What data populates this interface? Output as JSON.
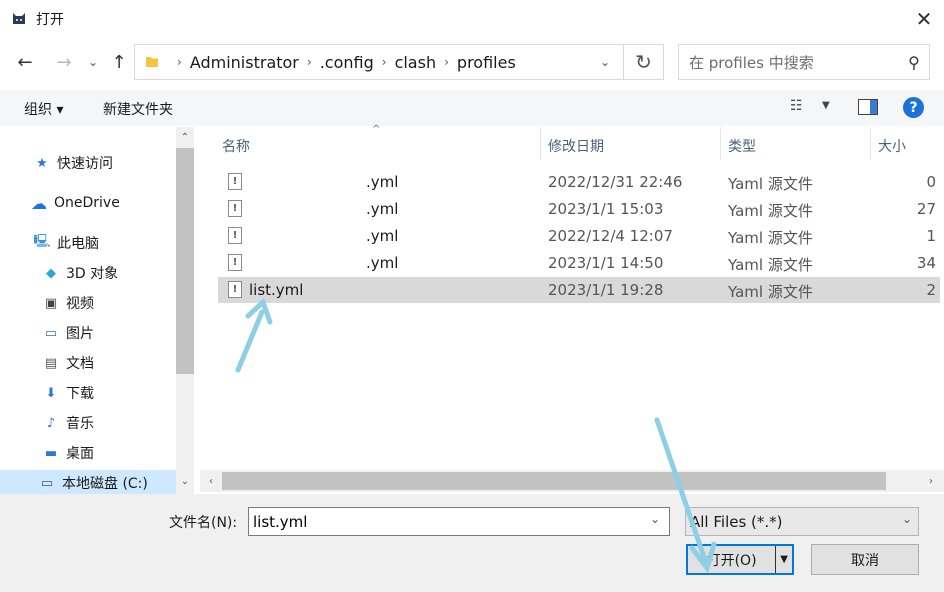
{
  "window": {
    "title": "打开"
  },
  "nav": {
    "breadcrumbs": [
      "Administrator",
      ".config",
      "clash",
      "profiles"
    ],
    "search_placeholder": "在 profiles 中搜索"
  },
  "toolbar": {
    "organize": "组织 ▾",
    "new_folder": "新建文件夹"
  },
  "sidebar": {
    "items": [
      {
        "label": "快速访问",
        "icon": "star-icon"
      },
      {
        "label": "OneDrive",
        "icon": "cloud-icon"
      },
      {
        "label": "此电脑",
        "icon": "computer-icon"
      },
      {
        "label": "3D 对象",
        "icon": "cube-icon"
      },
      {
        "label": "视频",
        "icon": "video-icon"
      },
      {
        "label": "图片",
        "icon": "picture-icon"
      },
      {
        "label": "文档",
        "icon": "document-icon"
      },
      {
        "label": "下载",
        "icon": "download-icon"
      },
      {
        "label": "音乐",
        "icon": "music-icon"
      },
      {
        "label": "桌面",
        "icon": "desktop-icon"
      },
      {
        "label": "本地磁盘 (C:)",
        "icon": "drive-icon"
      }
    ]
  },
  "columns": {
    "name": "名称",
    "date": "修改日期",
    "type": "类型",
    "size": "大小"
  },
  "files": [
    {
      "name": ".yml",
      "date": "2022/12/31 22:46",
      "type": "Yaml 源文件",
      "size": "0"
    },
    {
      "name": ".yml",
      "date": "2023/1/1 15:03",
      "type": "Yaml 源文件",
      "size": "27"
    },
    {
      "name": ".yml",
      "date": "2022/12/4 12:07",
      "type": "Yaml 源文件",
      "size": "1"
    },
    {
      "name": ".yml",
      "date": "2023/1/1 14:50",
      "type": "Yaml 源文件",
      "size": "34"
    },
    {
      "name": "list.yml",
      "date": "2023/1/1 19:28",
      "type": "Yaml 源文件",
      "size": "2"
    }
  ],
  "footer": {
    "filename_label": "文件名(N):",
    "filename_value": "list.yml",
    "filter": "All Files (*.*)",
    "open": "打开(O)",
    "cancel": "取消"
  },
  "colors": {
    "accent": "#0078d7",
    "selected_row": "#d9d9d9",
    "annotation_arrow": "#8ecfe6"
  }
}
